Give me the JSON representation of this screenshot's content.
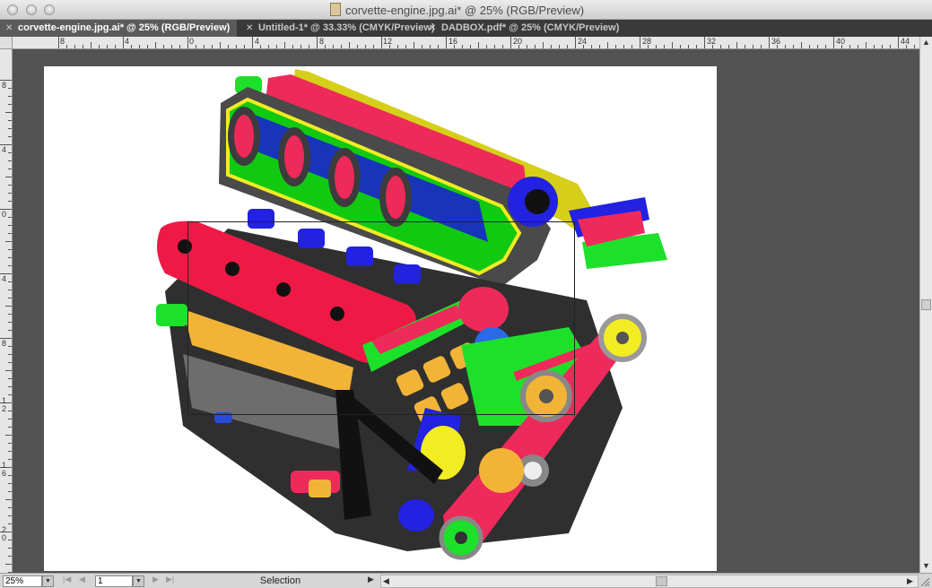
{
  "window": {
    "title": "corvette-engine.jpg.ai* @ 25% (RGB/Preview)"
  },
  "tabs": [
    {
      "label": "corvette-engine.jpg.ai* @ 25% (RGB/Preview)",
      "active": true
    },
    {
      "label": "Untitled-1* @ 33.33% (CMYK/Preview)",
      "active": false
    },
    {
      "label": "DADBOX.pdf* @ 25% (CMYK/Preview)",
      "active": false
    }
  ],
  "ruler": {
    "horizontal_labels": [
      "8",
      "4",
      "0",
      "4",
      "8",
      "12",
      "16",
      "20",
      "24",
      "28",
      "32",
      "36",
      "40",
      "44"
    ],
    "vertical_labels": [
      "8",
      "4",
      "0",
      "4",
      "8",
      "12",
      "16",
      "20"
    ]
  },
  "status": {
    "zoom": "25%",
    "page": "1",
    "tool": "Selection"
  },
  "icons": {
    "close_tab": "close-icon",
    "first_page": "first-page-icon",
    "prev_page": "prev-page-icon",
    "next_page": "next-page-icon",
    "last_page": "last-page-icon",
    "dropdown": "chevron-down-icon",
    "scroll_left": "scroll-left-icon",
    "scroll_right": "scroll-right-icon",
    "scroll_down": "scroll-down-icon",
    "resize": "resize-grip-icon"
  },
  "colors": {
    "app_background": "#535353",
    "tab_active": "#5b5b5b",
    "artboard": "#ffffff"
  }
}
